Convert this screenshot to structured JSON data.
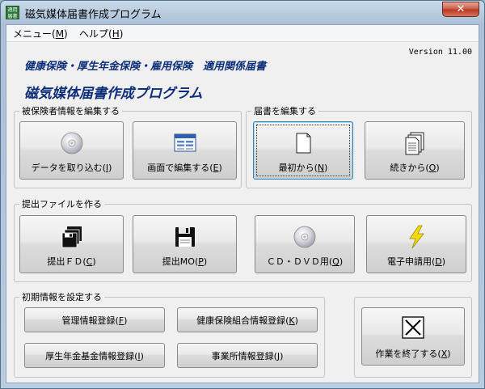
{
  "window": {
    "title": "磁気媒体届書作成プログラム",
    "app_icon_text": "適用\n届書",
    "close_glyph": "✕"
  },
  "menu": [
    {
      "label": "メニュー(",
      "key": "M",
      "suffix": ")"
    },
    {
      "label": "ヘルプ(",
      "key": "H",
      "suffix": ")"
    }
  ],
  "header": {
    "version": "Version 11.00",
    "subtitle": "健康保険・厚生年金保険・雇用保険　適用関係届書",
    "title": "磁気媒体届書作成プログラム"
  },
  "groups": {
    "edit_insured": {
      "label": "被保険者情報を編集する",
      "buttons": [
        {
          "label": "データを取り込む(",
          "key": "I",
          "suffix": ")",
          "icon": "cd-icon"
        },
        {
          "label": "画面で編集する(",
          "key": "E",
          "suffix": ")",
          "icon": "window-edit-icon"
        }
      ]
    },
    "edit_notice": {
      "label": "届書を編集する",
      "buttons": [
        {
          "label": "最初から(",
          "key": "N",
          "suffix": ")",
          "icon": "blank-document-icon"
        },
        {
          "label": "続きから(",
          "key": "O",
          "suffix": ")",
          "icon": "documents-stack-icon"
        }
      ]
    },
    "make_file": {
      "label": "提出ファイルを作る",
      "buttons": [
        {
          "label": "提出ＦＤ(",
          "key": "C",
          "suffix": ")",
          "icon": "floppy-stack-icon"
        },
        {
          "label": "提出MO(",
          "key": "P",
          "suffix": ")",
          "icon": "floppy-disk-icon"
        },
        {
          "label": "ＣＤ・ＤＶＤ用(",
          "key": "Q",
          "suffix": ")",
          "icon": "cd-icon"
        },
        {
          "label": "電子申請用(",
          "key": "D",
          "suffix": ")",
          "icon": "lightning-icon"
        }
      ]
    },
    "initial_settings": {
      "label": "初期情報を設定する",
      "buttons": [
        {
          "label": "管理情報登録(",
          "key": "F",
          "suffix": ")"
        },
        {
          "label": "健康保険組合情報登録(",
          "key": "K",
          "suffix": ")"
        },
        {
          "label": "厚生年金基金情報登録(",
          "key": "I",
          "suffix": ")"
        },
        {
          "label": "事業所情報登録(",
          "key": "J",
          "suffix": ")"
        }
      ]
    }
  },
  "exit_button": {
    "label": "作業を終了する(",
    "key": "X",
    "suffix": ")",
    "icon": "close-x-icon"
  }
}
